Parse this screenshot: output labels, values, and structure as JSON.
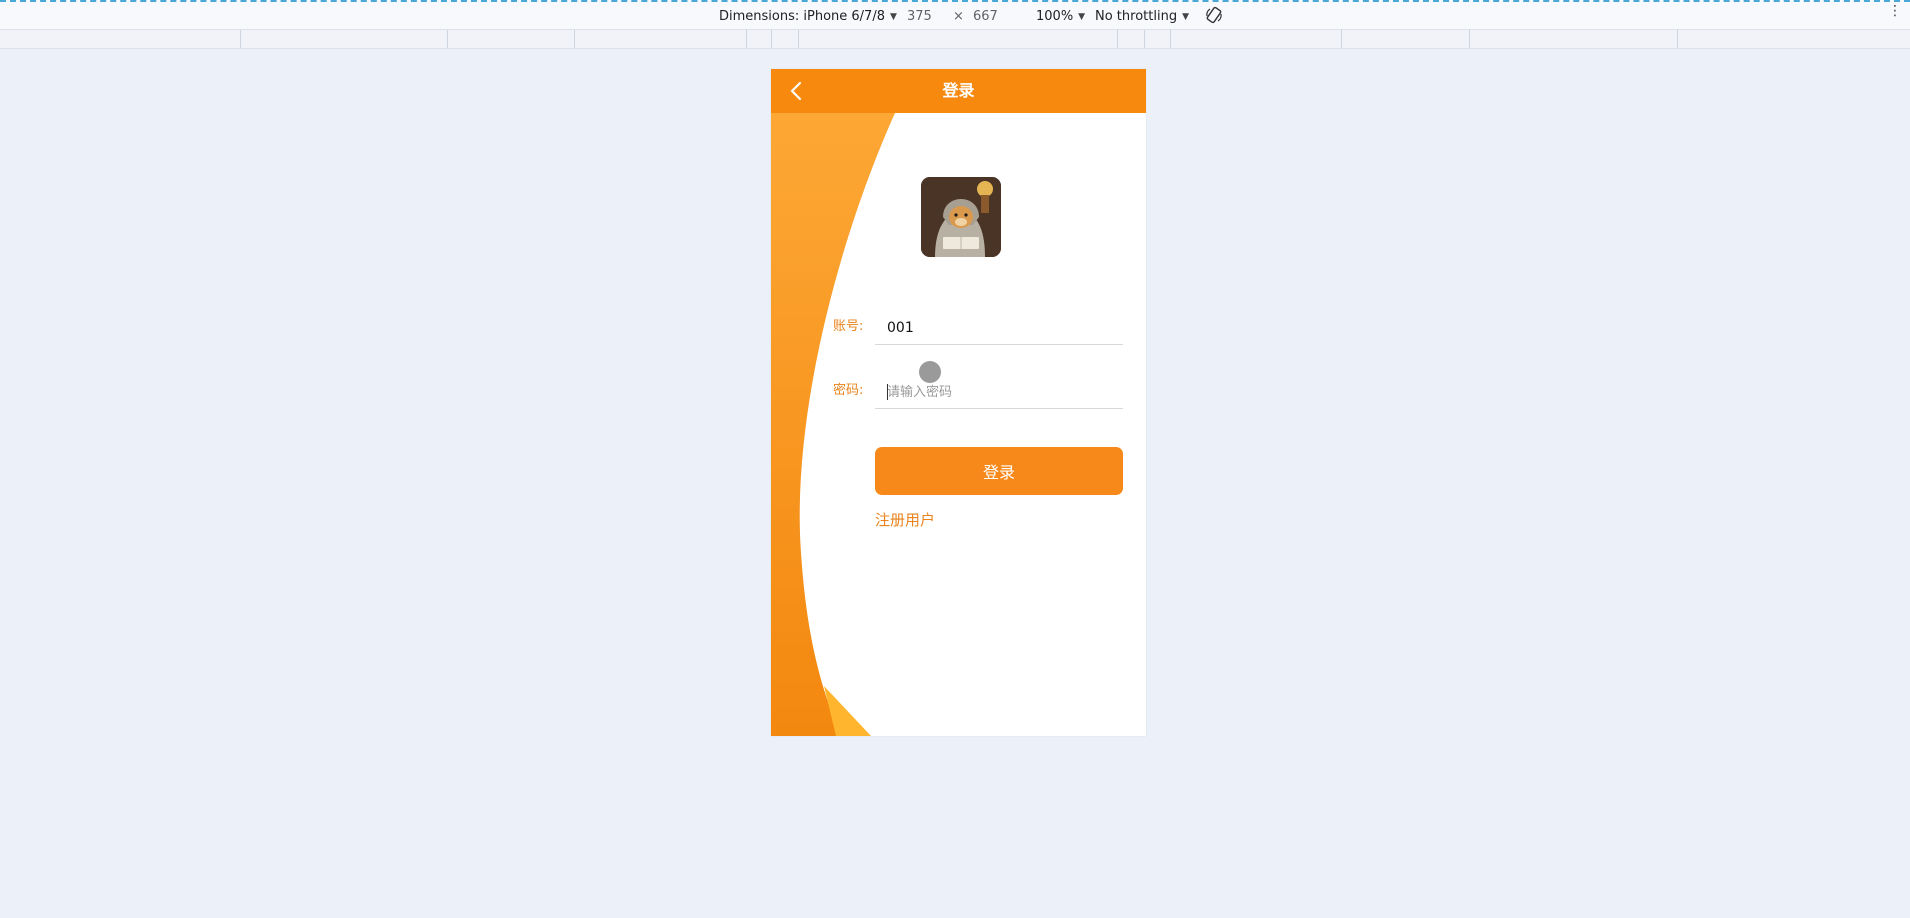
{
  "devtools": {
    "device_label": "Dimensions: iPhone 6/7/8",
    "width": "375",
    "times": "×",
    "height": "667",
    "zoom": "100%",
    "throttling": "No throttling",
    "rotate_icon": "rotate-icon",
    "menu_icon": "more-vertical-icon"
  },
  "header": {
    "title": "登录",
    "back_icon": "chevron-left-icon"
  },
  "form": {
    "account_label": "账号:",
    "account_value": "001",
    "password_label": "密码:",
    "password_placeholder": "请输入密码"
  },
  "actions": {
    "login_label": "登录",
    "register_label": "注册用户"
  },
  "colors": {
    "primary": "#f7890f",
    "accent_text": "#e8831d",
    "page_bg": "#ebf0f9"
  }
}
